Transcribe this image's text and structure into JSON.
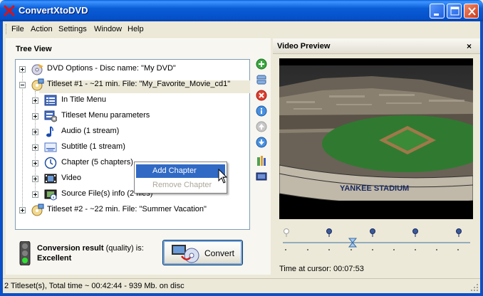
{
  "window": {
    "title": "ConvertXtoDVD"
  },
  "menu": [
    "File",
    "Action",
    "Settings",
    "Window",
    "Help"
  ],
  "tree_view": {
    "header": "Tree View",
    "nodes": [
      {
        "label": "DVD Options - Disc name: \"My DVD\"",
        "icon": "dvd-options-icon"
      },
      {
        "label": "Titleset #1 - ~21 min. File: \"My_Favorite_Movie_cd1\"",
        "icon": "titleset-icon"
      },
      {
        "label": "In Title Menu",
        "icon": "menu-icon"
      },
      {
        "label": "Titleset Menu parameters",
        "icon": "menu-params-icon"
      },
      {
        "label": "Audio (1 stream)",
        "icon": "audio-icon"
      },
      {
        "label": "Subtitle (1 stream)",
        "icon": "subtitle-icon"
      },
      {
        "label": "Chapter (5 chapters)",
        "icon": "chapter-icon"
      },
      {
        "label": "Video",
        "icon": "video-icon"
      },
      {
        "label": "Source File(s) info (2 files)",
        "icon": "source-files-icon"
      },
      {
        "label": "Titleset #2 - ~22 min. File: \"Summer Vacation\"",
        "icon": "titleset-icon"
      }
    ]
  },
  "context_menu": {
    "items": [
      "Add Chapter",
      "Remove Chapter"
    ]
  },
  "conversion": {
    "label_bold": "Conversion result",
    "label_rest": " (quality) is:",
    "value": "Excellent",
    "convert_label": "Convert"
  },
  "preview": {
    "title": "Video Preview",
    "close": "×",
    "time_label": "Time at cursor: 00:07:53",
    "stadium_text": "YANKEE   STADIUM"
  },
  "status": {
    "text": "2 Titleset(s), Total time ~ 00:42:44 - 939 Mb. on disc"
  },
  "colors": {
    "titlebar": "#0a5cd6",
    "selection": "#316ac5",
    "menu_highlight": "#316ac5"
  }
}
